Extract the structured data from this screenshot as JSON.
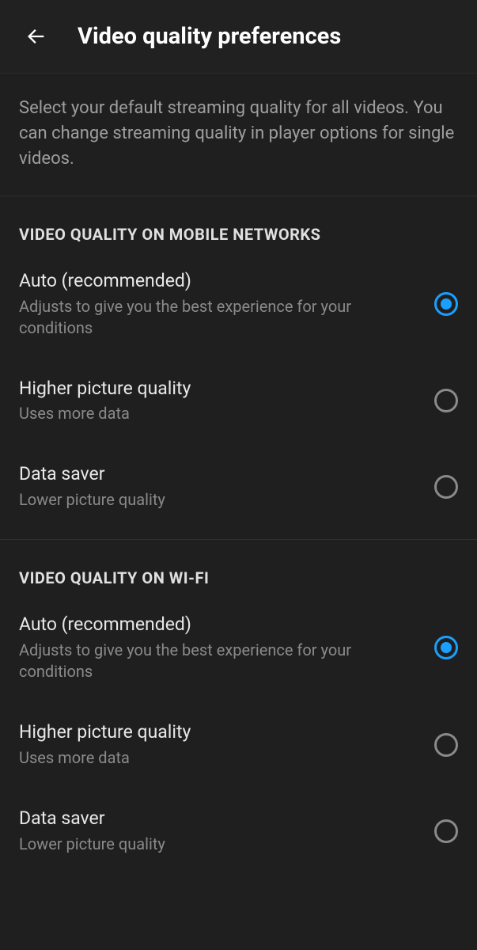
{
  "header": {
    "title": "Video quality preferences"
  },
  "description": "Select your default streaming quality for all videos. You can change streaming quality in player options for single videos.",
  "sections": [
    {
      "heading": "VIDEO QUALITY ON MOBILE NETWORKS",
      "options": [
        {
          "title": "Auto (recommended)",
          "subtitle": "Adjusts to give you the best experience for your conditions",
          "selected": true
        },
        {
          "title": "Higher picture quality",
          "subtitle": "Uses more data",
          "selected": false
        },
        {
          "title": "Data saver",
          "subtitle": "Lower picture quality",
          "selected": false
        }
      ]
    },
    {
      "heading": "VIDEO QUALITY ON WI-FI",
      "options": [
        {
          "title": "Auto (recommended)",
          "subtitle": "Adjusts to give you the best experience for your conditions",
          "selected": true
        },
        {
          "title": "Higher picture quality",
          "subtitle": "Uses more data",
          "selected": false
        },
        {
          "title": "Data saver",
          "subtitle": "Lower picture quality",
          "selected": false
        }
      ]
    }
  ],
  "colors": {
    "accent": "#1a9fff"
  }
}
